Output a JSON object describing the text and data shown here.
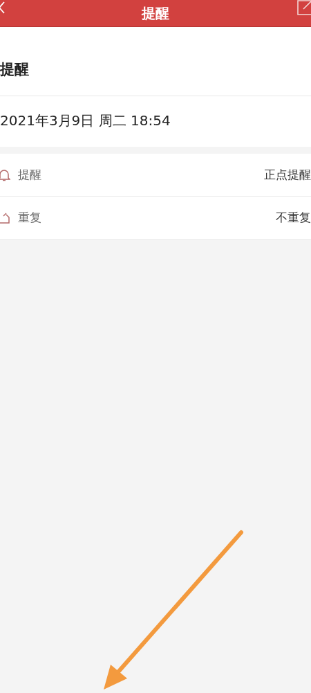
{
  "header": {
    "title": "提醒"
  },
  "heading": "提醒",
  "datetime": "2021年3月9日 周二 18:54",
  "settings": [
    {
      "kind": "reminder",
      "label": "提醒",
      "value": "正点提醒"
    },
    {
      "kind": "repeat",
      "label": "重复",
      "value": "不重复"
    }
  ]
}
